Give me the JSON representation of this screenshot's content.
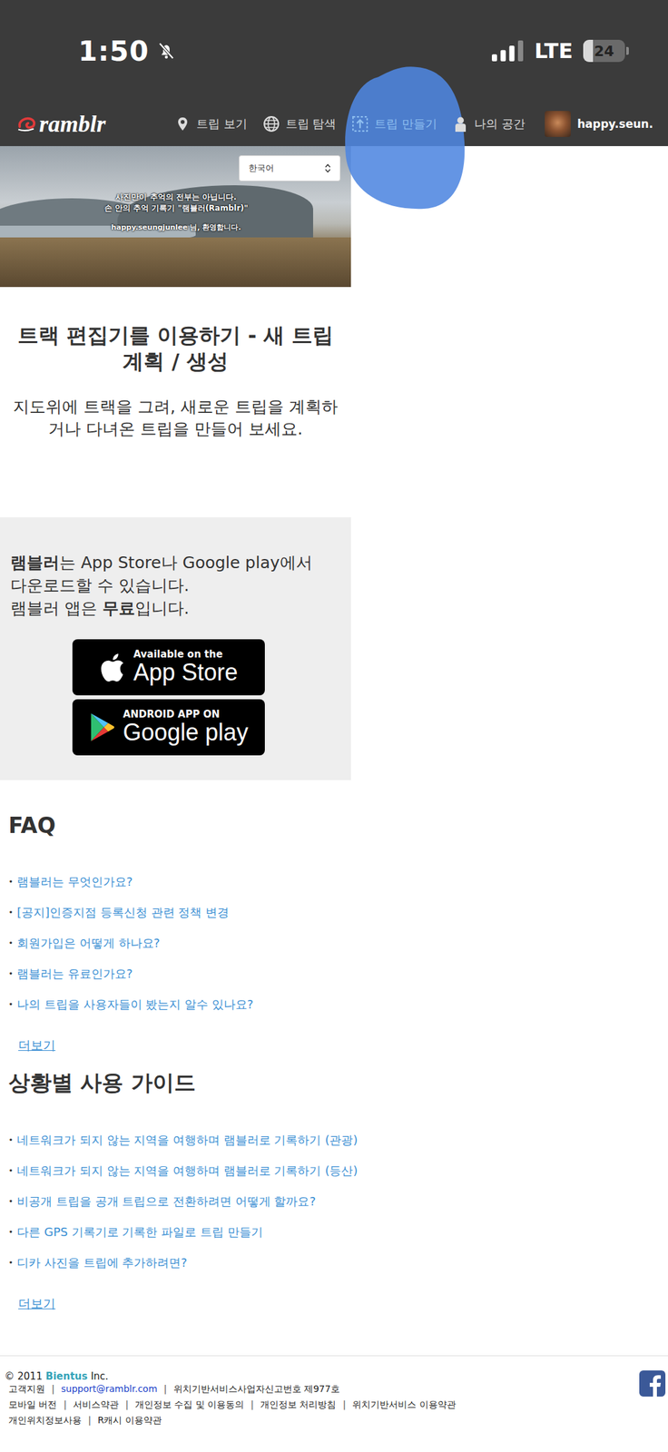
{
  "status_bar": {
    "time": "1:50",
    "network": "LTE",
    "battery": "24",
    "battery_level": 0.24
  },
  "nav": {
    "logo": "ramblr",
    "items": [
      {
        "label": "트립 보기",
        "selected": false
      },
      {
        "label": "트립 탐색",
        "selected": false
      },
      {
        "label": "트립 만들기",
        "selected": true
      },
      {
        "label": "나의 공간",
        "selected": false
      }
    ],
    "user": "happy.seun."
  },
  "hero": {
    "language": "한국어",
    "tagline": [
      "사진만이 추억의 전부는 아닙니다.",
      "손 안의 추억 기록기 \"램블러(Ramblr)\""
    ],
    "welcome": "happy.seungjunlee 님, 환영합니다."
  },
  "intro": {
    "title": "트랙 편집기를 이용하기 - 새 트립 계획 / 생성",
    "subtitle": "지도위에 트랙을 그려, 새로운 트립을 계획하거나 다녀온 트립을 만들어 보세요."
  },
  "download": {
    "lines": [
      [
        {
          "text": "램블러",
          "bold": true
        },
        {
          "text": "는 App Store나 Google play에서",
          "bold": false
        }
      ],
      [
        {
          "text": "다운로드할 수 있습니다.",
          "bold": false
        }
      ],
      [
        {
          "text": "램블러 앱은 ",
          "bold": false
        },
        {
          "text": "무료",
          "bold": true
        },
        {
          "text": "입니다.",
          "bold": false
        }
      ]
    ],
    "buttons": [
      {
        "small": "Available on the",
        "big": "App Store"
      },
      {
        "small": "ANDROID APP ON",
        "big": "Google play"
      }
    ]
  },
  "faq": {
    "title": "FAQ",
    "items": [
      "램블러는 무엇인가요?",
      "[공지]인증지점 등록신청 관련 정책 변경",
      "회원가입은 어떻게 하나요?",
      "램블러는 유료인가요?",
      "나의 트립을 사용자들이 봤는지 알수 있나요?"
    ],
    "more": "더보기"
  },
  "guide": {
    "title": "상황별 사용 가이드",
    "items": [
      "네트워크가 되지 않는 지역을 여행하며 램블러로 기록하기 (관광)",
      "네트워크가 되지 않는 지역을 여행하며 램블러로 기록하기 (등산)",
      "비공개 트립을 공개 트립으로 전환하려면 어떻게 할까요?",
      "다른 GPS 기록기로 기록한 파일로 트립 만들기",
      "디카 사진을 트립에 추가하려면?"
    ],
    "more": "더보기"
  },
  "footer": {
    "copyright": {
      "prefix": "© 2011",
      "company": "Bientus",
      "suffix": "Inc."
    },
    "separator": "|",
    "lines": [
      [
        {
          "text": "고객지원",
          "link": false
        },
        {
          "text": "support@ramblr.com",
          "link": true
        },
        {
          "text": "위치기반서비스사업자신고번호 제977호",
          "link": false
        }
      ],
      [
        {
          "text": "모바일 버전",
          "link": false
        },
        {
          "text": "서비스약관",
          "link": false
        },
        {
          "text": "개인정보 수집 및 이용동의",
          "link": false
        },
        {
          "text": "개인정보 처리방침",
          "link": false
        },
        {
          "text": "위치기반서비스 이용약관",
          "link": false
        }
      ],
      [
        {
          "text": "개인위치정보사용",
          "link": false
        },
        {
          "text": "R캐시 이용약관",
          "link": false
        }
      ]
    ]
  }
}
